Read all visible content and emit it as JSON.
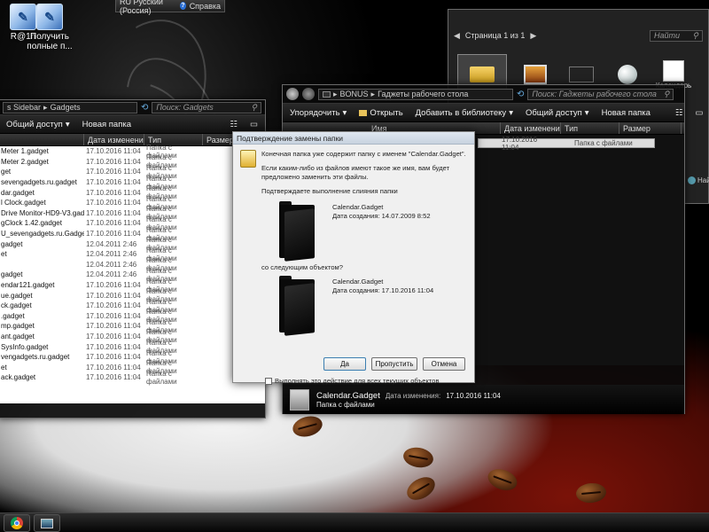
{
  "desktop": {
    "icons": [
      {
        "label": "R@1n",
        "icon": "shortcut-icon"
      },
      {
        "label": "Получить полные п...",
        "icon": "gadget-download-icon"
      }
    ]
  },
  "language_bar": {
    "language": "RU Русский (Россия)",
    "help": "Справка"
  },
  "left_window": {
    "breadcrumb_tail": "s Sidebar",
    "breadcrumb_current": "Gadgets",
    "search_placeholder": "Поиск: Gadgets",
    "commands": [
      "Общий доступ",
      "Новая папка"
    ],
    "columns": [
      "Дата изменения",
      "Тип",
      "Размер"
    ],
    "rows": [
      {
        "name": "Meter 1.gadget",
        "date": "17.10.2016 11:04",
        "type": "Папка с файлами"
      },
      {
        "name": "Meter 2.gadget",
        "date": "17.10.2016 11:04",
        "type": "Папка с файлами"
      },
      {
        "name": "get",
        "date": "17.10.2016 11:04",
        "type": "Папка с файлами"
      },
      {
        "name": "sevengadgets.ru.gadget",
        "date": "17.10.2016 11:04",
        "type": "Папка с файлами"
      },
      {
        "name": "dar.gadget",
        "date": "17.10.2016 11:04",
        "type": "Папка с файлами"
      },
      {
        "name": "l Clock.gadget",
        "date": "17.10.2016 11:04",
        "type": "Папка с файлами"
      },
      {
        "name": "Drive Monitor-HD9-V3.gadget",
        "date": "17.10.2016 11:04",
        "type": "Папка с файлами"
      },
      {
        "name": "gClock 1.42.gadget",
        "date": "17.10.2016 11:04",
        "type": "Папка с файлами"
      },
      {
        "name": "U_sevengadgets.ru.Gadget",
        "date": "17.10.2016 11:04",
        "type": "Папка с файлами"
      },
      {
        "name": "gadget",
        "date": "12.04.2011 2:46",
        "type": "Папка с файлами"
      },
      {
        "name": "et",
        "date": "12.04.2011 2:46",
        "type": "Папка с файлами"
      },
      {
        "name": "",
        "date": "12.04.2011 2:46",
        "type": "Папка с файлами"
      },
      {
        "name": "gadget",
        "date": "12.04.2011 2:46",
        "type": "Папка с файлами"
      },
      {
        "name": "endar121.gadget",
        "date": "17.10.2016 11:04",
        "type": "Папка с файлами"
      },
      {
        "name": "ue.gadget",
        "date": "17.10.2016 11:04",
        "type": "Папка с файлами"
      },
      {
        "name": "ck.gadget",
        "date": "17.10.2016 11:04",
        "type": "Папка с файлами"
      },
      {
        "name": ".gadget",
        "date": "17.10.2016 11:04",
        "type": "Папка с файлами"
      },
      {
        "name": "mp.gadget",
        "date": "17.10.2016 11:04",
        "type": "Папка с файлами"
      },
      {
        "name": "ant.gadget",
        "date": "17.10.2016 11:04",
        "type": "Папка с файлами"
      },
      {
        "name": "SysInfo.gadget",
        "date": "17.10.2016 11:04",
        "type": "Папка с файлами"
      },
      {
        "name": "vengadgets.ru.gadget",
        "date": "17.10.2016 11:04",
        "type": "Папка с файлами"
      },
      {
        "name": "et",
        "date": "17.10.2016 11:04",
        "type": "Папка с файлами"
      },
      {
        "name": "ack.gadget",
        "date": "17.10.2016 11:04",
        "type": "Папка с файлами"
      }
    ]
  },
  "gadget_gallery": {
    "page_label": "Страница 1 из 1",
    "search_placeholder": "Найти",
    "calendar_label": "Календарь"
  },
  "right_window": {
    "breadcrumb": [
      "BONUS",
      "Гаджеты рабочего стола"
    ],
    "search_placeholder": "Поиск: Гаджеты рабочего стола",
    "commands": [
      "Упорядочить",
      "Открыть",
      "Добавить в библиотеку",
      "Общий доступ",
      "Новая папка"
    ],
    "columns": [
      "Имя",
      "Дата изменения",
      "Тип",
      "Размер"
    ],
    "selected_row": {
      "date": "17.10.2016 11:04",
      "type": "Папка с файлами"
    },
    "details": {
      "name": "Calendar.Gadget",
      "date_label": "Дата изменения:",
      "date": "17.10.2016 11:04",
      "type": "Папка с файлами"
    },
    "side_button_label": "Найт"
  },
  "dialog": {
    "title": "Подтверждение замены папки",
    "message": "Конечная папка уже содержит папку с именем \"Calendar.Gadget\".",
    "warning": "Если каким-либо из файлов имеют такое же имя, вам будет предложено заменить эти файлы.",
    "confirm_question": "Подтверждаете выполнение слияния папки",
    "existing": {
      "name": "Calendar.Gadget",
      "created": "Дата создания: 14.07.2009 8:52"
    },
    "with_label": "со следующим объектом?",
    "incoming": {
      "name": "Calendar.Gadget",
      "created": "Дата создания: 17.10.2016 11:04"
    },
    "yes_label": "Да",
    "skip_label": "Пропустить",
    "cancel_label": "Отмена",
    "apply_all_label": "Выполнять это действие для всех текущих объектов"
  },
  "colors": {
    "accent": "#2a6fd6",
    "dialog_bg": "#f0f0f0",
    "window_dark": "#0a0a0a"
  }
}
